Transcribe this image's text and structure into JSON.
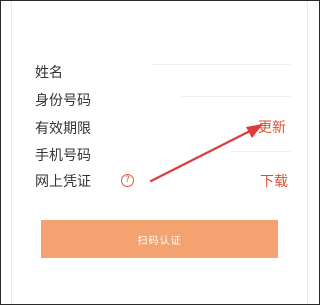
{
  "form": {
    "rows": [
      {
        "label": "姓名"
      },
      {
        "label": "身份号码"
      },
      {
        "label": "有效期限",
        "action": "更新"
      },
      {
        "label": "手机号码"
      },
      {
        "label": "网上凭证",
        "help_icon": "question-circle-icon",
        "action": "下载"
      }
    ],
    "button_label": "扫码认证"
  },
  "colors": {
    "accent": "#e0502e",
    "button": "#f5a271",
    "arrow": "#e03a3a"
  }
}
